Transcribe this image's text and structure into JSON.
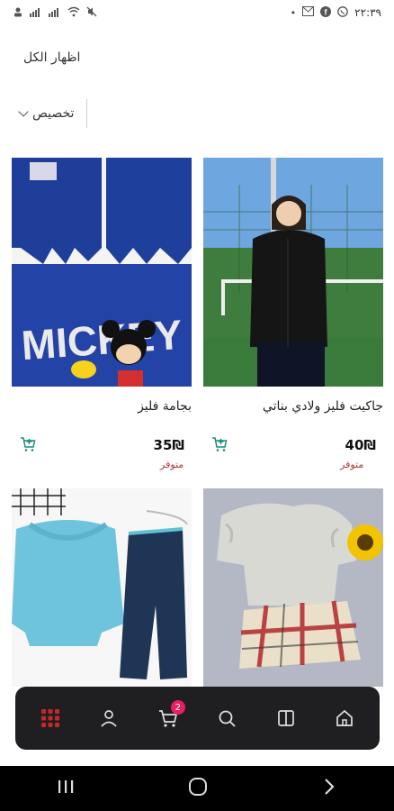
{
  "status": {
    "time": "٢٢:٣٩"
  },
  "header": {
    "show_all": "اظهار الكل"
  },
  "filter": {
    "label": "تخصيص"
  },
  "products": [
    {
      "title": "جاكيت فليز ولادي بناتي",
      "price": "40₪",
      "stock": "متوفر"
    },
    {
      "title": "بجامة فليز",
      "price": "35₪",
      "stock": "متوفر"
    },
    {
      "title": "",
      "price": "",
      "stock": ""
    },
    {
      "title": "",
      "price": "",
      "stock": ""
    }
  ],
  "nav": {
    "cart_badge": "2"
  },
  "colors": {
    "accent": "#e91e63",
    "nav_bg": "#1f1f22",
    "stock_text": "#b33a3a",
    "grid_icon": "#c62828"
  }
}
